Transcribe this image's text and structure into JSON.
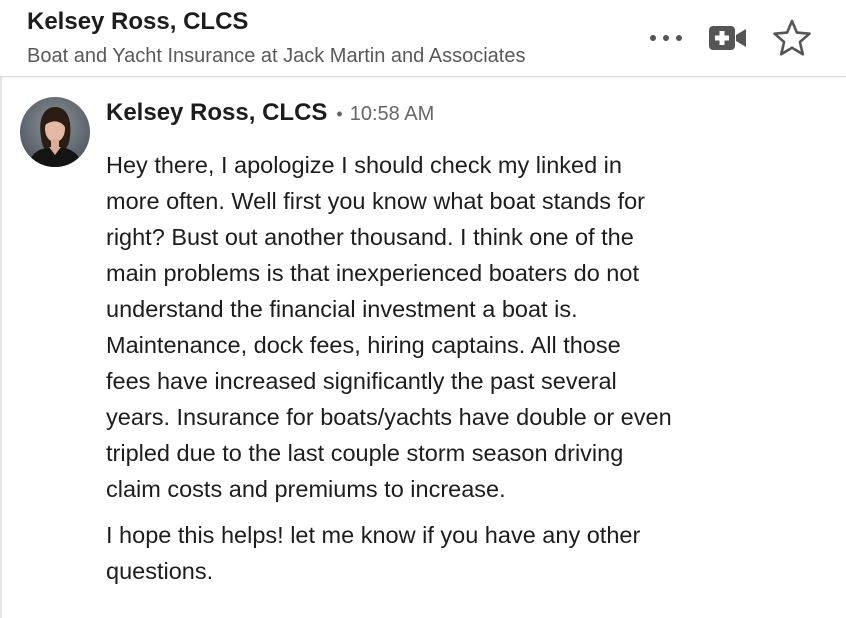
{
  "conversation_header": {
    "name": "Kelsey Ross, CLCS",
    "headline": "Boat and Yacht Insurance at Jack Martin and Associates",
    "actions": [
      {
        "icon": "more-options-icon"
      },
      {
        "icon": "video-call-icon"
      },
      {
        "icon": "star-icon"
      }
    ]
  },
  "message": {
    "sender": "Kelsey Ross, CLCS",
    "separator": "•",
    "time": "10:58 AM",
    "avatar": "profile-photo",
    "paragraphs": [
      {
        "lines": [
          "Hey there, I apologize I should check my linked in",
          "more often.  Well first you know what boat stands for",
          "right?  Bust out another thousand.  I think one of the",
          "main problems is that inexperienced boaters do not",
          "understand the financial investment a boat is.",
          "Maintenance, dock fees, hiring captains.  All those",
          "fees have increased significantly the past several",
          "years.  Insurance for boats/yachts have double or even",
          "tripled due to the last couple storm season driving",
          "claim costs and premiums to increase."
        ]
      },
      {
        "lines": [
          "I hope this helps! let me know if you have any other",
          "questions."
        ]
      }
    ]
  },
  "colors": {
    "text_primary": "#1d1d1d",
    "text_secondary": "#595959",
    "icon": "#555555",
    "divider": "#dcdcdc"
  }
}
